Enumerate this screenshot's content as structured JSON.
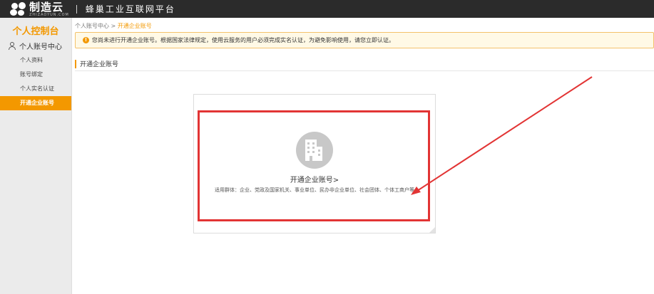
{
  "header": {
    "logo_text": "制造云",
    "logo_sub": "ZHIZAOYUN.COM",
    "platform": "蜂巢工业互联网平台"
  },
  "sidebar": {
    "title": "个人控制台",
    "section": "个人账号中心",
    "items": [
      {
        "label": "个人资料",
        "active": false
      },
      {
        "label": "账号绑定",
        "active": false
      },
      {
        "label": "个人实名认证",
        "active": false
      },
      {
        "label": "开通企业账号",
        "active": true
      }
    ]
  },
  "breadcrumb": {
    "parent": "个人账号中心",
    "separator": " > ",
    "current": "开通企业账号"
  },
  "notice": {
    "text": "您尚未进行开通企业账号。根据国家法律规定，使用云服务的用户必须完成实名认证，为避免影响使用，请您立即认证。"
  },
  "section": {
    "title": "开通企业账号"
  },
  "card": {
    "link_text": "开通企业账号>",
    "description": "适用群体：企业、党政及国家机关、事业单位、民办非企业单位、社会团体、个体工商户等"
  },
  "colors": {
    "accent": "#f39800",
    "highlight": "#e23434",
    "topbar": "#2b2b2b"
  }
}
